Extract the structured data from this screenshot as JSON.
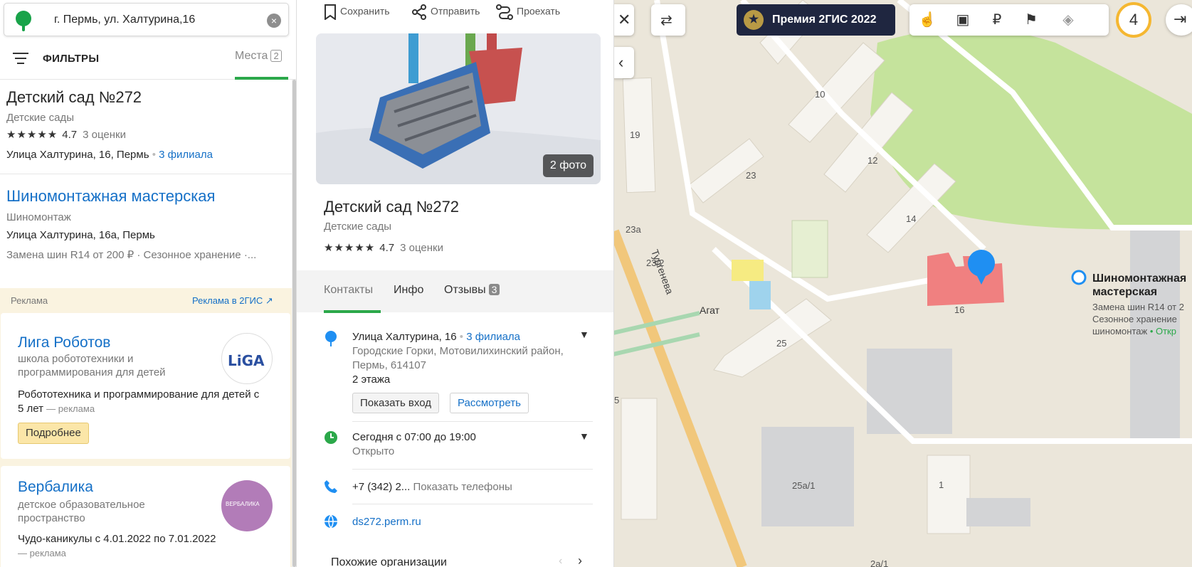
{
  "search": {
    "query": "г. Пермь, ул. Халтурина,16",
    "clear_label": "×"
  },
  "filters": {
    "label": "ФИЛЬТРЫ",
    "places_label": "Места",
    "places_count": "2"
  },
  "results": [
    {
      "title": "Детский сад №272",
      "category": "Детские сады",
      "stars": "★★★★★",
      "rating": "4.7",
      "reviews": "3 оценки",
      "address": "Улица Халтурина, 16, Пермь",
      "dot": "•",
      "branches": "3 филиала"
    },
    {
      "title": "Шиномонтажная мастерская",
      "category": "Шиномонтаж",
      "address": "Улица Халтурина, 16а, Пермь",
      "promo": "Замена шин R14 от 200 ₽ · Сезонное хранение ·..."
    }
  ],
  "ads": {
    "header": "Реклама",
    "link": "Реклама в 2ГИС ↗",
    "items": [
      {
        "title": "Лига Роботов",
        "subtitle": "школа робототехники и программирования для детей",
        "desc": "Робототехника и программирование для детей с 5 лет",
        "ad_mark": "— реклама",
        "button": "Подробнее",
        "logo_text": "LiGA"
      },
      {
        "title": "Вербалика",
        "subtitle": "детское образовательное пространство",
        "desc": "Чудо-каникулы с 4.01.2022 по 7.01.2022",
        "ad_mark": "— реклама",
        "logo_text": "ВЕРБАЛИКА"
      }
    ]
  },
  "details": {
    "actions": {
      "save": "Сохранить",
      "send": "Отправить",
      "route": "Проехать"
    },
    "photo_count": "2 фото",
    "title": "Детский сад №272",
    "category": "Детские сады",
    "stars": "★★★★★",
    "rating": "4.7",
    "reviews": "3 оценки",
    "tabs": {
      "contacts": "Контакты",
      "info": "Инфо",
      "reviews": "Отзывы",
      "reviews_count": "3"
    },
    "address": {
      "street": "Улица Халтурина, 16",
      "dot": "•",
      "branches": "3 филиала",
      "district": "Городские Горки, Мотовилихинский район, Пермь, 614107",
      "floors": "2 этажа"
    },
    "buttons": {
      "show_entrance": "Показать вход",
      "view": "Рассмотреть"
    },
    "hours": {
      "today": "Сегодня с 07:00 до 19:00",
      "status": "Открыто"
    },
    "phone": {
      "number": "+7 (342) 2...",
      "show": "Показать телефоны"
    },
    "website": "ds272.perm.ru",
    "similar": "Похожие организации"
  },
  "map": {
    "premium": "Премия 2ГИС 2022",
    "layers_count": "4",
    "labels": {
      "street": "Тургенева",
      "agat": "Агат",
      "b10": "10",
      "b12": "12",
      "b14": "14",
      "b19": "19",
      "b23": "23",
      "b23a": "23а",
      "b23_2": "23/2",
      "b25": "25",
      "b16": "16",
      "b1": "1",
      "b25a1": "25а/1",
      "b2a1": "2а/1",
      "b5": "5"
    },
    "poi": {
      "title": "Шиномонтажная мастерская",
      "line1": "Замена шин R14 от 2",
      "line2": "Сезонное хранение",
      "line3": "шиномонтаж",
      "open": "• Откр"
    }
  },
  "colors": {
    "accent_green": "#2ba84a",
    "link_blue": "#1570c7",
    "premium_bg": "#1f2640",
    "park_green": "#c5e39c",
    "selected_building": "#f08080",
    "pin_blue": "#1f8ff2"
  }
}
